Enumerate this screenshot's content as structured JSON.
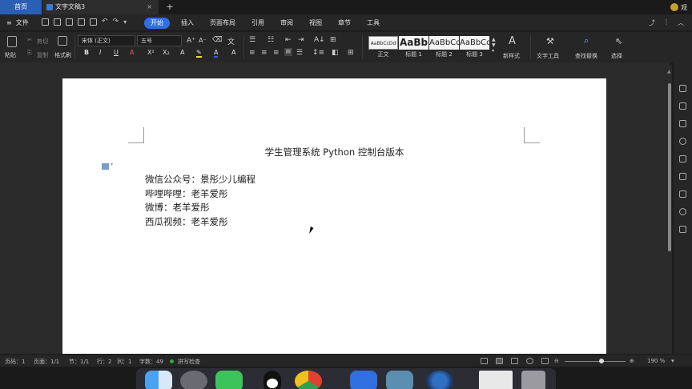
{
  "tabs": {
    "home": "首页",
    "document": "文字文稿3",
    "add": "+",
    "close": "×"
  },
  "user": {
    "name": "观"
  },
  "menu": {
    "file": "文件",
    "tabs": [
      "开始",
      "插入",
      "页面布局",
      "引用",
      "审阅",
      "视图",
      "章节",
      "工具"
    ]
  },
  "ribbon": {
    "paste": "粘贴",
    "cut": "剪切",
    "copy": "复制",
    "format_painter": "格式刷",
    "font_name": "宋体 (正文)",
    "font_size": "五号",
    "styles": [
      {
        "preview": "AaBbCcDd",
        "label": "正文"
      },
      {
        "preview": "AaBb",
        "label": "标题 1"
      },
      {
        "preview": "AaBbCc",
        "label": "标题 2"
      },
      {
        "preview": "AaBbCc",
        "label": "标题 3"
      }
    ],
    "new_style": "新样式",
    "text_tools": "文字工具",
    "find_replace": "查找替换",
    "select": "选择"
  },
  "document": {
    "title": "学生管理系统 Python 控制台版本",
    "lines": [
      "微信公众号：景彤少儿编程",
      "哔哩哔哩：老羊爱彤",
      "微博：老羊爱彤",
      "西瓜视频：老羊爱彤"
    ]
  },
  "status": {
    "page_num": "页码：1",
    "pages": "页面：1/1",
    "section": "节：1/1",
    "row": "行：2",
    "column": "列：1",
    "word_count": "字数：49",
    "spell_check": "拼写检查",
    "zoom": "190 %"
  },
  "colors": {
    "accent": "#2f6fe0",
    "home_tab": "#2b5fb4",
    "spell_ok": "#2da84a"
  }
}
